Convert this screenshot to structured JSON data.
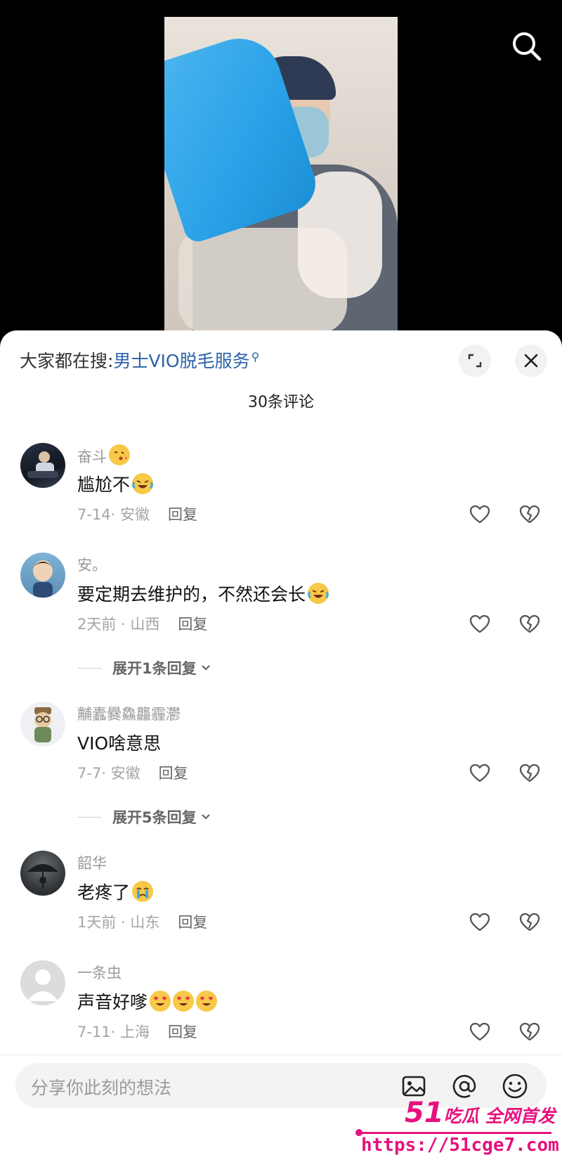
{
  "trending": {
    "prefix": "大家都在搜:",
    "keyword": "男士VIO脱毛服务"
  },
  "comment_count": "30条评论",
  "comments": [
    {
      "user": "奋斗",
      "text": "尴尬不",
      "location": "7-14· 安徽",
      "reply_label": "回复"
    },
    {
      "user": "安。",
      "text": "要定期去维护的，不然还会长",
      "location": "2天前 · 山西",
      "reply_label": "回复",
      "expand": "展开1条回复"
    },
    {
      "user": "黼蠹爨鱻龘霾灪",
      "text": "VIO啥意思",
      "location": "7-7· 安徽",
      "reply_label": "回复",
      "expand": "展开5条回复"
    },
    {
      "user": "韶华",
      "text": "老疼了",
      "location": "1天前 · 山东",
      "reply_label": "回复"
    },
    {
      "user": "一条虫",
      "text": "声音好嗲",
      "location": "7-11· 上海",
      "reply_label": "回复"
    }
  ],
  "input": {
    "placeholder": "分享你此刻的想法"
  },
  "watermark": {
    "brand_num": "51",
    "brand_text": "吃瓜 全网首发",
    "url": "https://51cge7.com"
  },
  "icons": [
    "search-icon",
    "expand-icon",
    "close-icon",
    "heart-icon",
    "broken-heart-icon",
    "chevron-down-icon",
    "image-icon",
    "at-icon",
    "emoji-icon"
  ],
  "colors": {
    "link": "#2b63a8",
    "watermark": "#e5127d"
  }
}
